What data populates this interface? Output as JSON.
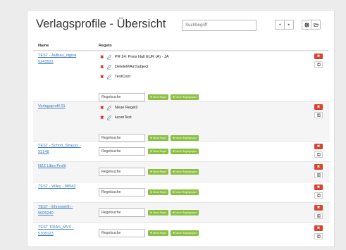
{
  "title": "Verlagsprofile - Übersicht",
  "search": {
    "placeholder": "Suchbegriff"
  },
  "toolbar": {
    "prev": "◂",
    "next": "▸"
  },
  "columns": {
    "name": "Name",
    "rules": "Regeln"
  },
  "labels": {
    "rule_search": "Regelsuche",
    "new_rule": "✚ Neue Regel",
    "new_rule_group": "✚ Neue Regelgruppe",
    "delete": "✖"
  },
  "rows": [
    {
      "name": "TEST - Aufbau_digital 5243522",
      "rules": [
        "PR 24: Preis Null EUR (A) - JA",
        "DeleteMAinSubject",
        "TestCont"
      ]
    },
    {
      "name": "Verlagsprofil 01",
      "rules": [
        "Neue Regel2",
        "iuconTest"
      ]
    },
    {
      "name": "TEST - Schott_Strauss - 93148",
      "rules": []
    },
    {
      "name": "NZZ Libro Profil",
      "rules": []
    },
    {
      "name": "TEST - Wiley - 88942",
      "rules": []
    },
    {
      "name": "TEST - Ehrenwirth - 5005240",
      "rules": []
    },
    {
      "name": "TEST TRIAS_MVS - 5108123",
      "rules": []
    }
  ]
}
